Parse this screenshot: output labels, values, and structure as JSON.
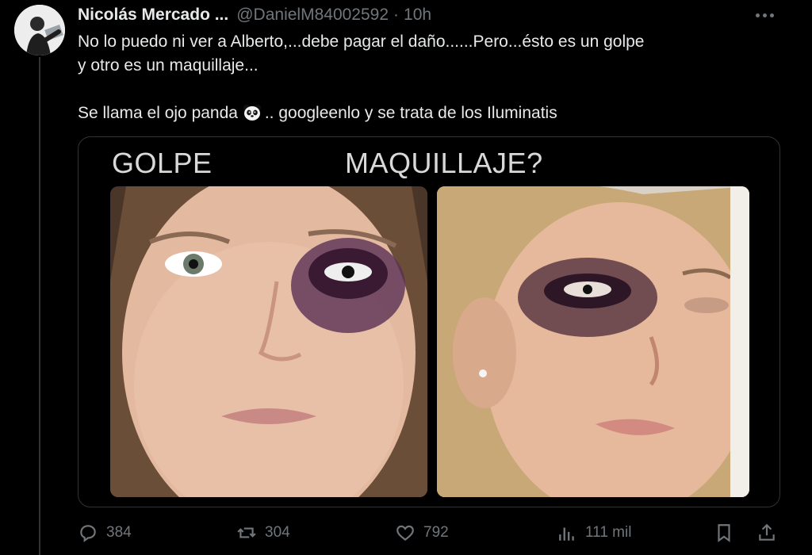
{
  "tweet": {
    "author_name": "Nicolás Mercado ...",
    "handle": "@DanielM84002592",
    "separator": "·",
    "time": "10h",
    "text_line1": "No lo puedo ni ver a Alberto,...debe pagar el daño......Pero...ésto es un golpe",
    "text_line2": "y otro es un maquillaje...",
    "text_line3_before": "Se llama el ojo panda",
    "text_line3_after": ".. googleenlo y se trata de los Iluminatis"
  },
  "image": {
    "label_left": "GOLPE",
    "label_right": "MAQUILLAJE?"
  },
  "actions": {
    "replies": "384",
    "reposts": "304",
    "likes": "792",
    "views": "111 mil"
  },
  "icons": [
    "more-icon",
    "panda-emoji-icon",
    "reply-icon",
    "repost-icon",
    "like-icon",
    "views-icon",
    "bookmark-icon",
    "share-icon"
  ],
  "colors": {
    "background": "#000000",
    "text": "#e7e9ea",
    "muted": "#71767b",
    "border": "#2f3336"
  }
}
